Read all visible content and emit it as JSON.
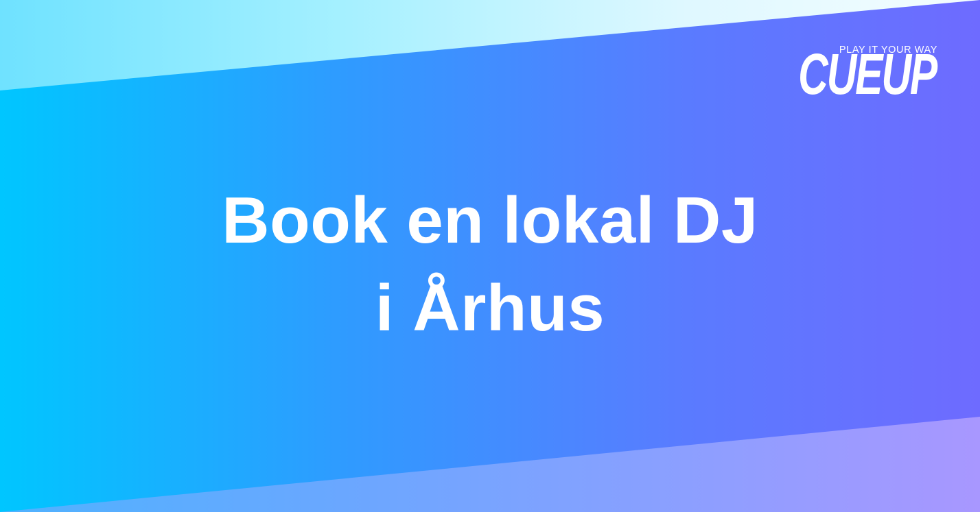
{
  "logo": {
    "tagline": "PLAY IT YOUR WAY",
    "wordmark": "CUEUP"
  },
  "headline": {
    "line1": "Book en lokal DJ",
    "line2": "i Århus"
  },
  "colors": {
    "gradient_start": "#00c6ff",
    "gradient_end": "#6e6bff",
    "text": "#ffffff"
  }
}
